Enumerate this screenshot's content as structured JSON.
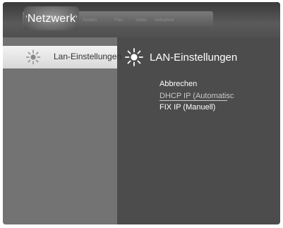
{
  "tabs": {
    "active": "Netzwerk",
    "others": [
      "System",
      "Foto",
      "Video",
      "Aufnahme"
    ]
  },
  "sidebar": {
    "items": [
      {
        "label": "Lan-Einstellungen",
        "icon": "sun-icon"
      }
    ]
  },
  "content": {
    "title": "LAN-Einstellungen",
    "title_icon": "sun-icon",
    "options": [
      "Abbrechen",
      "DHCP IP (Automatisc",
      "FIX IP (Manuell)"
    ],
    "selected_index": 1
  }
}
